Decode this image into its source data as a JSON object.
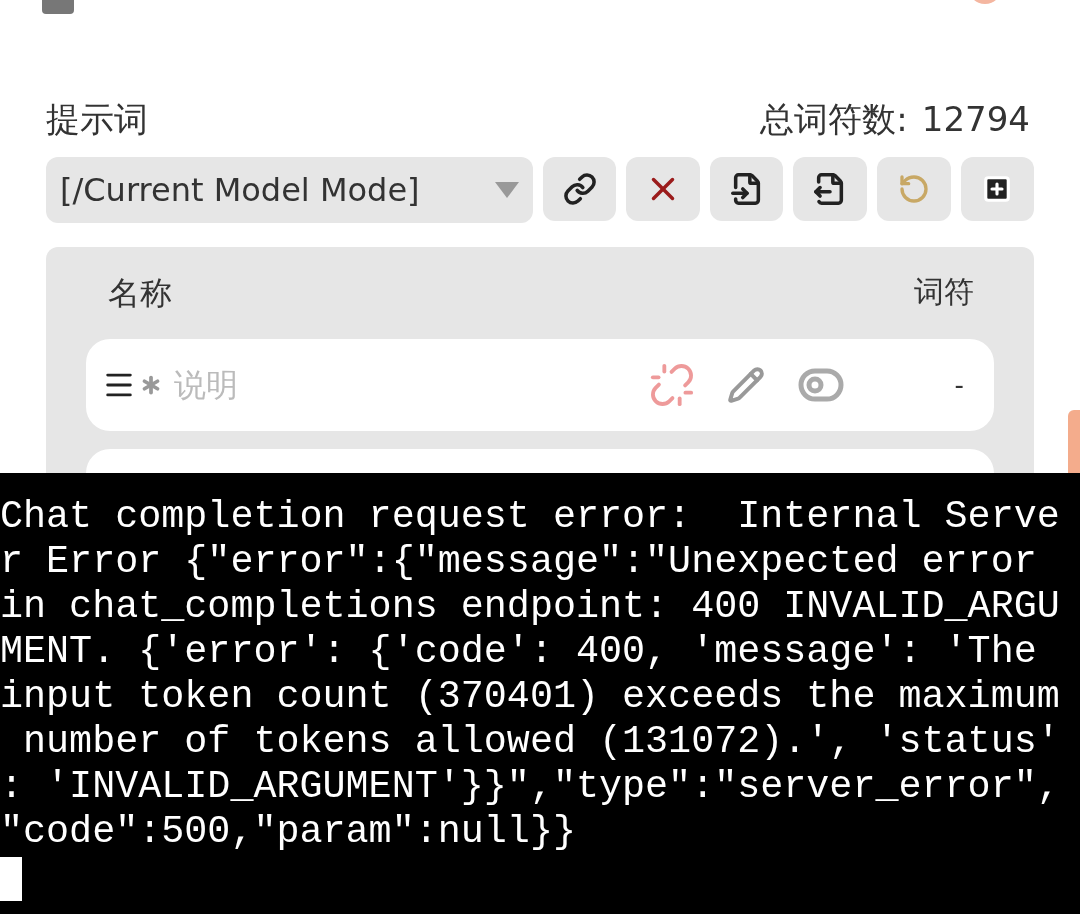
{
  "header": {
    "title": "提示词",
    "total_label": "总词符数:",
    "total_value": "12794"
  },
  "toolbar": {
    "preset": "[/Current Model Mode]"
  },
  "table": {
    "columns": [
      "名称",
      "词符"
    ],
    "rows": [
      {
        "name": "说明",
        "enabled": false,
        "tokens": "-"
      }
    ]
  },
  "terminal": {
    "lines": [
      "Chat completion request error:  Internal Serve",
      "r Error {\"error\":{\"message\":\"Unexpected error",
      "in chat_completions endpoint: 400 INVALID_ARGU",
      "MENT. {'error': {'code': 400, 'message': 'The",
      "input token count (370401) exceeds the maximum",
      " number of tokens allowed (131072).', 'status'",
      ": 'INVALID_ARGUMENT'}}\",\"type\":\"server_error\",",
      "\"code\":500,\"param\":null}}"
    ]
  }
}
